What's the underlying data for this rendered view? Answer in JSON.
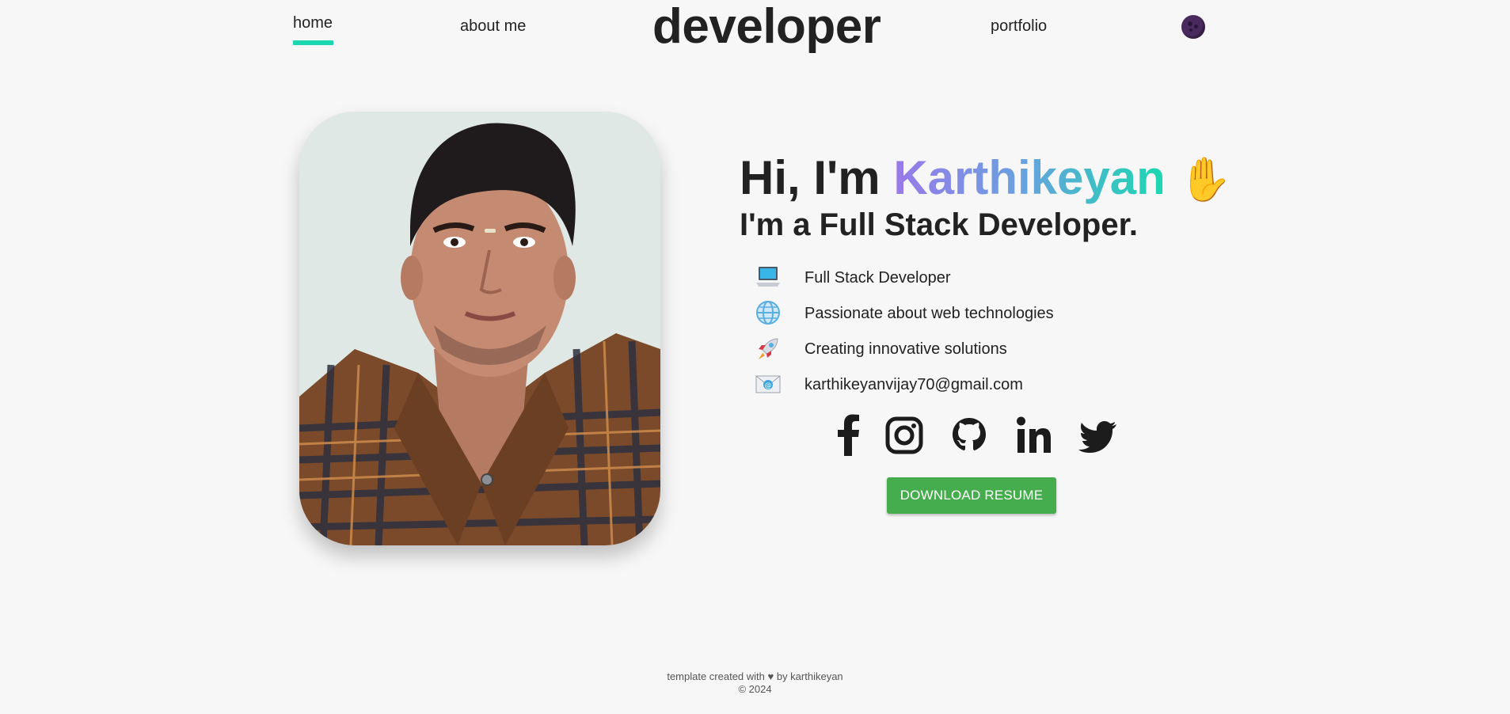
{
  "nav": {
    "home": "home",
    "about": "about me",
    "logo": "developer",
    "portfolio": "portfolio"
  },
  "hero": {
    "greeting": "Hi, I'm",
    "name": "Karthikeyan",
    "wave": "✋",
    "subtitle": "I'm a Full Stack Developer.",
    "features": [
      {
        "icon": "laptop-icon",
        "text": "Full Stack Developer"
      },
      {
        "icon": "globe-icon",
        "text": "Passionate about web technologies"
      },
      {
        "icon": "rocket-icon",
        "text": "Creating innovative solutions"
      },
      {
        "icon": "email-icon",
        "text": "karthikeyanvijay70@gmail.com"
      }
    ],
    "socials": [
      "facebook-icon",
      "instagram-icon",
      "github-icon",
      "linkedin-icon",
      "twitter-icon"
    ],
    "resume_button": "DOWNLOAD RESUME"
  },
  "footer": {
    "line1": "template created with ♥ by karthikeyan",
    "line2": "© 2024"
  },
  "colors": {
    "background": "#f7f7f7",
    "accent_teal": "#1bd7b0",
    "accent_purple": "#9a79ea",
    "button_green": "#46ad4e",
    "text": "#222222"
  }
}
